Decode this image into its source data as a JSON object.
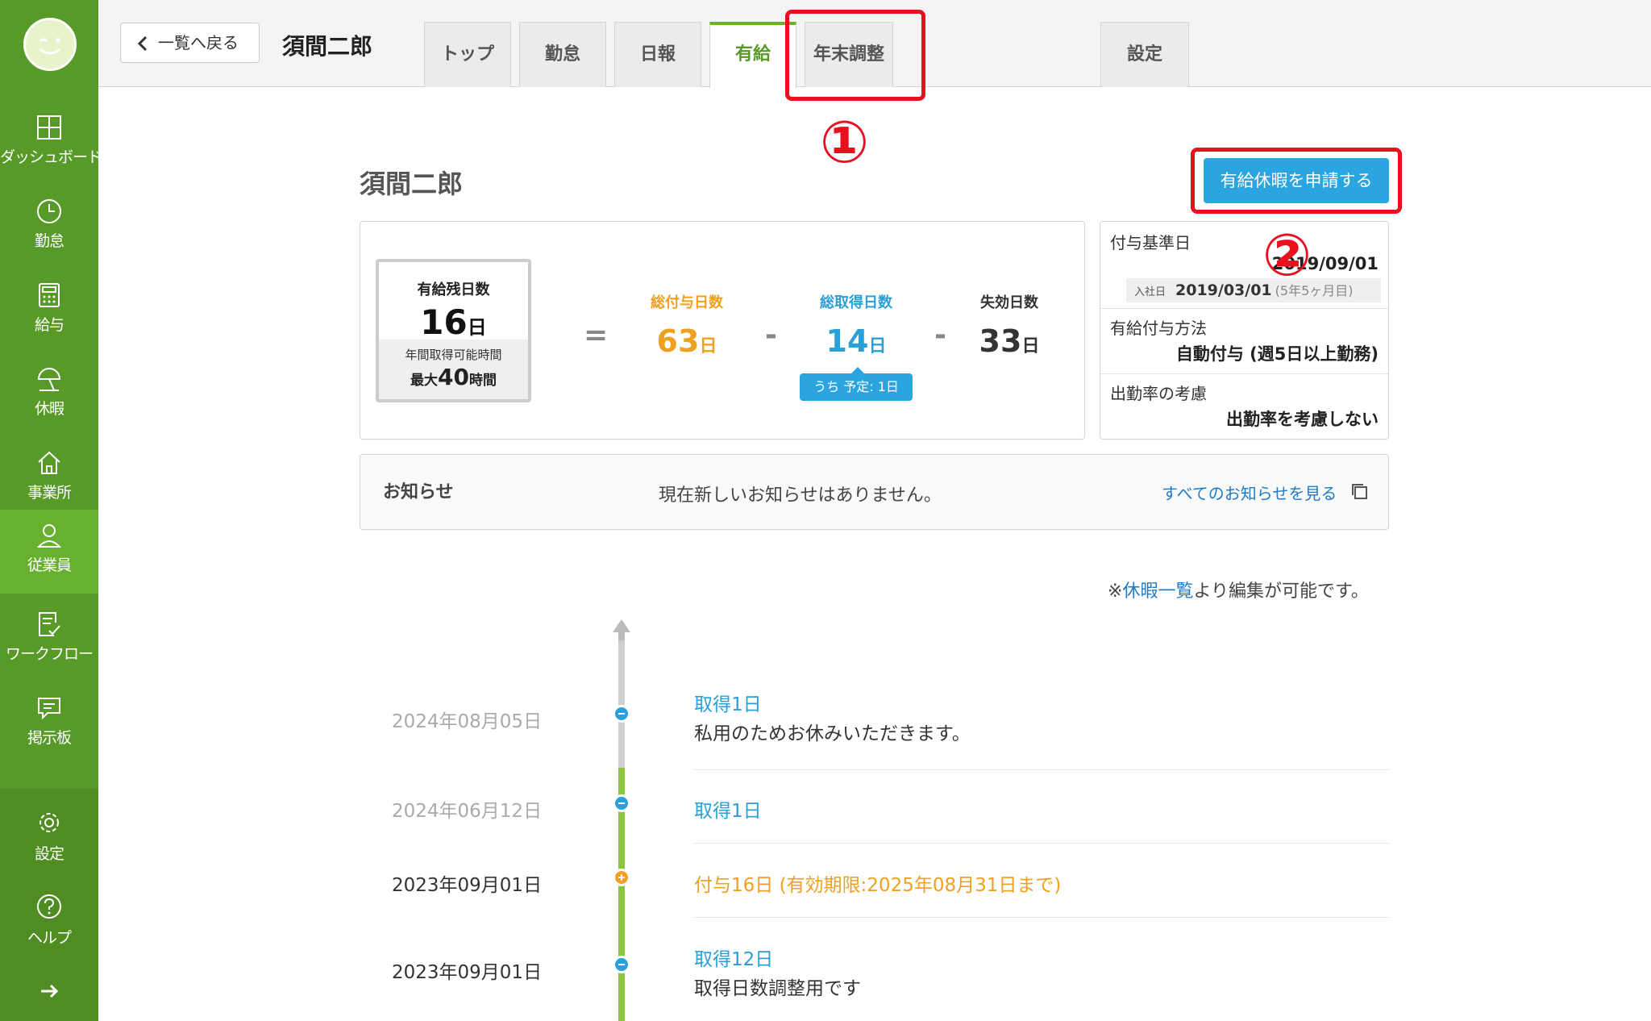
{
  "sidebar": {
    "items": [
      {
        "label": "ダッシュボード",
        "icon": "dashboard-icon"
      },
      {
        "label": "勤怠",
        "icon": "clock-icon"
      },
      {
        "label": "給与",
        "icon": "calculator-icon"
      },
      {
        "label": "休暇",
        "icon": "parasol-icon"
      },
      {
        "label": "事業所",
        "icon": "home-icon"
      },
      {
        "label": "従業員",
        "icon": "person-icon"
      },
      {
        "label": "ワークフロー",
        "icon": "checklist-icon"
      },
      {
        "label": "掲示板",
        "icon": "chat-icon"
      }
    ],
    "bottom": [
      {
        "label": "設定",
        "icon": "gear-icon"
      },
      {
        "label": "ヘルプ",
        "icon": "help-icon"
      }
    ]
  },
  "topbar": {
    "back_label": "一覧へ戻る",
    "employee_name": "須間二郎",
    "tabs": [
      "トップ",
      "勤怠",
      "日報",
      "有給",
      "年末調整"
    ],
    "settings_tab": "設定"
  },
  "callouts": {
    "one": "①",
    "two": "②"
  },
  "main": {
    "title": "須間二郎",
    "apply_button": "有給休暇を申請する",
    "summary": {
      "remain_label": "有給残日数",
      "remain_value": "16",
      "day_unit": "日",
      "annual_hours_label": "年間取得可能時間",
      "annual_hours_prefix": "最大",
      "annual_hours_value": "40",
      "annual_hours_unit": "時間",
      "equals": "=",
      "minus": "-",
      "granted_label": "総付与日数",
      "granted_value": "63",
      "taken_label": "総取得日数",
      "taken_value": "14",
      "expired_label": "失効日数",
      "expired_value": "33",
      "planned_badge": "うち 予定: 1日"
    },
    "info": {
      "grant_base_label": "付与基準日",
      "grant_base_value": "2019/09/01",
      "join_label": "入社日",
      "join_value": "2019/03/01",
      "join_tenure": "(5年5ヶ月目)",
      "grant_method_label": "有給付与方法",
      "grant_method_value": "自動付与 (週5日以上勤務)",
      "attendance_label": "出勤率の考慮",
      "attendance_value": "出勤率を考慮しない"
    },
    "notice": {
      "title": "お知らせ",
      "message": "現在新しいお知らせはありません。",
      "link": "すべてのお知らせを見る"
    },
    "edit_note_prefix": "※",
    "edit_note_link": "休暇一覧",
    "edit_note_suffix": "より編集が可能です。"
  },
  "timeline": [
    {
      "date": "2024年08月05日",
      "title": "取得1日",
      "desc": "私用のためお休みいただきます。",
      "kind": "take"
    },
    {
      "date": "2024年06月12日",
      "title": "取得1日",
      "desc": "",
      "kind": "take"
    },
    {
      "date": "2023年09月01日",
      "title": "付与16日 (有効期限:2025年08月31日まで)",
      "desc": "",
      "kind": "grant"
    },
    {
      "date": "2023年09月01日",
      "title": "取得12日",
      "desc": "取得日数調整用です",
      "kind": "take"
    }
  ]
}
